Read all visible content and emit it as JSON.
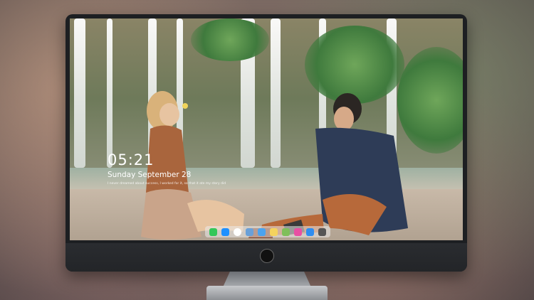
{
  "lock_screen": {
    "time": "05:21",
    "date": "Sunday September 28",
    "note": "I never dreamed about success, I worked for it, so that it ate my story did"
  },
  "dock": {
    "items": [
      {
        "name": "messages",
        "color": "#34c759"
      },
      {
        "name": "finder",
        "color": "#1e90ff"
      },
      {
        "name": "clock",
        "color": "#ffffff"
      },
      {
        "name": "preview",
        "color": "#6aa0d8"
      },
      {
        "name": "folder",
        "color": "#4aa3f0"
      },
      {
        "name": "notes",
        "color": "#f4d35e"
      },
      {
        "name": "photos",
        "color": "#7fbf5a"
      },
      {
        "name": "itunes",
        "color": "#e84fa3"
      },
      {
        "name": "app-store",
        "color": "#2f8df0"
      },
      {
        "name": "camera",
        "color": "#555555"
      }
    ]
  }
}
